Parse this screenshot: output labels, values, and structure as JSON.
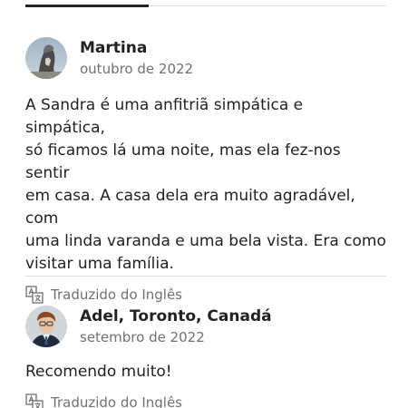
{
  "reviews": [
    {
      "name": "Martina",
      "date": "outubro de 2022",
      "text": "A Sandra é uma anfitriã simpática e simpática,\nsó ficamos lá uma noite, mas ela fez-nos sentir\nem casa. A casa dela era muito agradável, com\numa linda varanda e uma bela vista. Era como\nvisitar uma família.",
      "translated_label": "Traduzido do Inglês",
      "avatar_icon": "avatar-photo"
    },
    {
      "name": "Adel, Toronto, Canadá",
      "date": "setembro de 2022",
      "text": "Recomendo muito!",
      "translated_label": "Traduzido do Inglês",
      "avatar_icon": "avatar-photo"
    }
  ],
  "colors": {
    "text_primary": "#222222",
    "text_secondary": "#717171",
    "divider": "#dddddd",
    "tab_active": "#222222"
  },
  "icons": {
    "translate": "translate-icon"
  }
}
